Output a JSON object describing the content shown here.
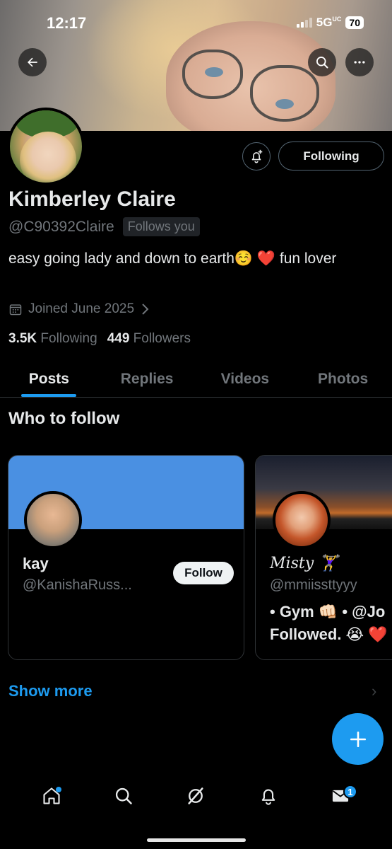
{
  "status_bar": {
    "time": "12:17",
    "network": "5G",
    "network_sub": "UC",
    "battery": "70"
  },
  "header": {
    "back_icon": "arrow-left-icon",
    "search_icon": "search-icon",
    "more_icon": "ellipsis-icon"
  },
  "profile": {
    "name": "Kimberley Claire",
    "handle": "@C90392Claire",
    "follows_you": "Follows you",
    "bio": "easy going lady and down to earth☺️ ❤️ fun lover",
    "joined": "Joined June 2025",
    "following_count": "3.5K",
    "following_label": "Following",
    "followers_count": "449",
    "followers_label": "Followers",
    "following_button": "Following"
  },
  "tabs": [
    {
      "label": "Posts",
      "active": true
    },
    {
      "label": "Replies",
      "active": false
    },
    {
      "label": "Videos",
      "active": false
    },
    {
      "label": "Photos",
      "active": false
    }
  ],
  "who_to_follow": {
    "title": "Who to follow",
    "cards": [
      {
        "name": "kay",
        "handle": "@KanishaRuss...",
        "button": "Follow",
        "bio": ""
      },
      {
        "name": "Misty 🏋️‍♀️",
        "handle": "@mmiissttyyy",
        "button": "",
        "bio_line1": "• Gym 👊🏻 • @Jo",
        "bio_line2": "Followed. 😭 ❤️"
      }
    ],
    "show_more": "Show more"
  },
  "fab_icon": "plus-icon",
  "nav": {
    "items": [
      "home-icon",
      "search-icon",
      "grok-icon",
      "notifications-icon",
      "messages-icon"
    ],
    "messages_badge": "1"
  },
  "colors": {
    "accent": "#1d9bf0",
    "background": "#000000",
    "secondary_text": "#71767b"
  }
}
